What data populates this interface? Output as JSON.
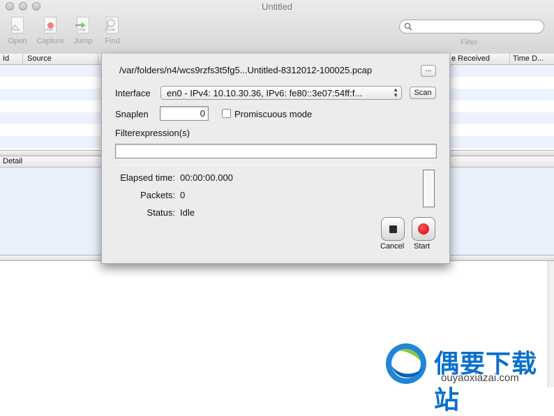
{
  "window": {
    "title": "Untitled"
  },
  "toolbar": {
    "open_label": "Open",
    "capture_label": "Capture",
    "jump_label": "Jump",
    "find_label": "Find",
    "filter_label": "Filter",
    "filter_value": ""
  },
  "table": {
    "columns": [
      "Id",
      "Source",
      "",
      "",
      "",
      "",
      "e Received",
      "Time D..."
    ],
    "rows": []
  },
  "detail": {
    "header": "Detail"
  },
  "dialog": {
    "file_path": "/var/folders/n4/wcs9rzfs3t5fg5...Untitled-8312012-100025.pcap",
    "browse_label": "...",
    "interface_label": "Interface",
    "interface_value": "en0 - IPv4: 10.10.30.36, IPv6: fe80::3e07:54ff:f...",
    "scan_label": "Scan",
    "snaplen_label": "Snaplen",
    "snaplen_value": "0",
    "promiscuous_label": "Promiscuous mode",
    "promiscuous_checked": false,
    "filterexpr_label": "Filterexpression(s)",
    "filterexpr_value": "",
    "elapsed_label": "Elapsed time:",
    "elapsed_value": "00:00:00.000",
    "packets_label": "Packets:",
    "packets_value": "0",
    "status_label": "Status:",
    "status_value": "Idle",
    "cancel_label": "Cancel",
    "start_label": "Start"
  },
  "watermark": {
    "title": "偶要下载站",
    "url": "ouyaoxiazai.com"
  }
}
